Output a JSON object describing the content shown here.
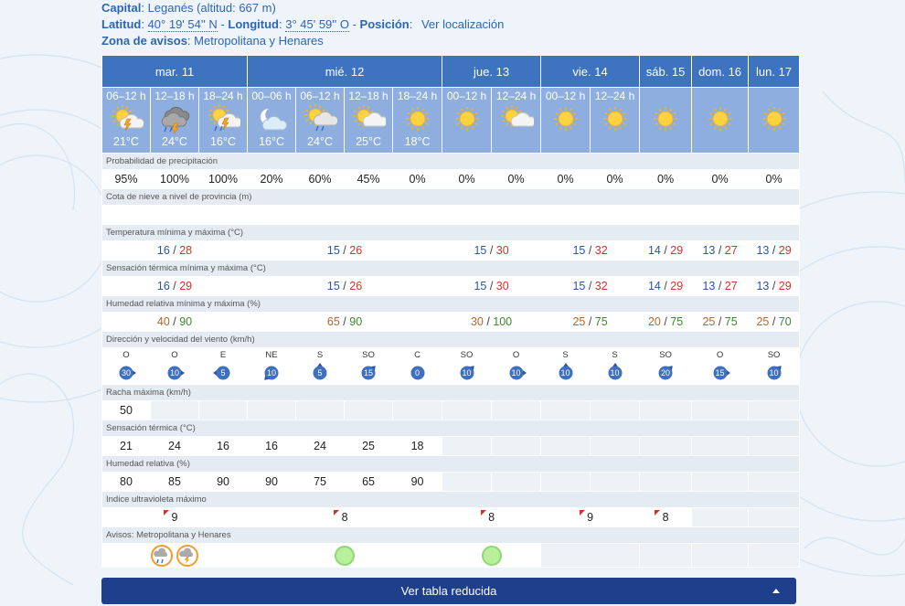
{
  "header": {
    "capital_label": "Capital",
    "capital_value": "Leganés (altitud: 667 m)",
    "lat_label": "Latitud",
    "lat_value": "40° 19' 54'' N",
    "lon_label": "Longitud",
    "lon_value": "3° 45' 59'' O",
    "pos_label": "Posición",
    "pos_link": "Ver localización",
    "zona_label": "Zona de avisos",
    "zona_value": "Metropolitana y Henares"
  },
  "days": [
    {
      "label": "mar. 11",
      "span": 3
    },
    {
      "label": "mié. 12",
      "span": 4
    },
    {
      "label": "jue. 13",
      "span": 2
    },
    {
      "label": "vie. 14",
      "span": 2
    },
    {
      "label": "sáb. 15",
      "span": 1
    },
    {
      "label": "dom. 16",
      "span": 1
    },
    {
      "label": "lun. 17",
      "span": 1
    }
  ],
  "periods": [
    {
      "label": "06–12 h",
      "icon": "sun-storm-icon",
      "temp": "21°C"
    },
    {
      "label": "12–18 h",
      "icon": "cloud-rain-storm-icon",
      "temp": "24°C"
    },
    {
      "label": "18–24 h",
      "icon": "sun-cloud-storm-icon",
      "temp": "16°C"
    },
    {
      "label": "00–06 h",
      "icon": "moon-cloud-icon",
      "temp": "16°C"
    },
    {
      "label": "06–12 h",
      "icon": "sun-cloud-rain-icon",
      "temp": "24°C"
    },
    {
      "label": "12–18 h",
      "icon": "sun-cloud-icon",
      "temp": "25°C"
    },
    {
      "label": "18–24 h",
      "icon": "sun-icon",
      "temp": "18°C"
    },
    {
      "label": "00–12 h",
      "icon": "sun-icon",
      "temp": ""
    },
    {
      "label": "12–24 h",
      "icon": "sun-cloud-icon",
      "temp": ""
    },
    {
      "label": "00–12 h",
      "icon": "sun-icon",
      "temp": ""
    },
    {
      "label": "12–24 h",
      "icon": "sun-icon",
      "temp": ""
    },
    {
      "label": "",
      "icon": "sun-icon",
      "temp": ""
    },
    {
      "label": "",
      "icon": "sun-icon",
      "temp": ""
    },
    {
      "label": "",
      "icon": "sun-icon",
      "temp": ""
    }
  ],
  "labels": {
    "precip": "Probabilidad de precipitación",
    "snow": "Cota de nieve a nivel de provincia (m)",
    "temp": "Temperatura mínima y máxima (°C)",
    "sens": "Sensación térmica mínima y máxima (°C)",
    "hum": "Humedad relativa mínima y máxima (%)",
    "wind": "Dirección y velocidad del viento (km/h)",
    "racha": "Racha máxima (km/h)",
    "sens_t": "Sensación térmica (°C)",
    "hum_r": "Humedad relativa (%)",
    "uv": "Indice ultravioleta máximo",
    "avisos": "Avisos: Metropolitana y Henares"
  },
  "precip": [
    "95%",
    "100%",
    "100%",
    "20%",
    "60%",
    "45%",
    "0%",
    "0%",
    "0%",
    "0%",
    "0%",
    "0%",
    "0%",
    "0%"
  ],
  "temp_minmax": [
    {
      "min": "16",
      "max": "28"
    },
    {
      "min": "15",
      "max": "26"
    },
    {
      "min": "15",
      "max": "30"
    },
    {
      "min": "15",
      "max": "32"
    },
    {
      "min": "14",
      "max": "29"
    },
    {
      "min": "13",
      "max": "27"
    },
    {
      "min": "13",
      "max": "29"
    }
  ],
  "sens_minmax": [
    {
      "min": "16",
      "max": "29"
    },
    {
      "min": "15",
      "max": "26"
    },
    {
      "min": "15",
      "max": "30"
    },
    {
      "min": "15",
      "max": "32"
    },
    {
      "min": "14",
      "max": "29"
    },
    {
      "min": "13",
      "max": "27"
    },
    {
      "min": "13",
      "max": "29"
    }
  ],
  "hum_minmax": [
    {
      "min": "40",
      "max": "90"
    },
    {
      "min": "65",
      "max": "90"
    },
    {
      "min": "30",
      "max": "100"
    },
    {
      "min": "25",
      "max": "75"
    },
    {
      "min": "20",
      "max": "75"
    },
    {
      "min": "25",
      "max": "75"
    },
    {
      "min": "25",
      "max": "70"
    }
  ],
  "wind": [
    {
      "dir": "O",
      "speed": "30"
    },
    {
      "dir": "O",
      "speed": "10"
    },
    {
      "dir": "E",
      "speed": "5"
    },
    {
      "dir": "NE",
      "speed": "10"
    },
    {
      "dir": "S",
      "speed": "5"
    },
    {
      "dir": "SO",
      "speed": "15"
    },
    {
      "dir": "C",
      "speed": "0"
    },
    {
      "dir": "SO",
      "speed": "10"
    },
    {
      "dir": "O",
      "speed": "10"
    },
    {
      "dir": "S",
      "speed": "10"
    },
    {
      "dir": "S",
      "speed": "10"
    },
    {
      "dir": "SO",
      "speed": "20"
    },
    {
      "dir": "O",
      "speed": "15"
    },
    {
      "dir": "SO",
      "speed": "10"
    }
  ],
  "racha": [
    "50",
    "",
    "",
    "",
    "",
    "",
    "",
    "",
    "",
    "",
    "",
    "",
    "",
    ""
  ],
  "sens_t": [
    "21",
    "24",
    "16",
    "16",
    "24",
    "25",
    "18"
  ],
  "hum_r": [
    "80",
    "85",
    "90",
    "90",
    "75",
    "65",
    "90"
  ],
  "uv": [
    "9",
    "8",
    "8",
    "9",
    "8"
  ],
  "bottom_button": "Ver tabla reducida"
}
